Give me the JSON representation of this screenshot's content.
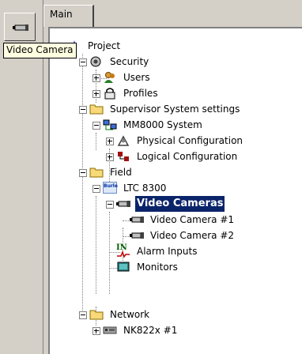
{
  "tab": {
    "label": "Main"
  },
  "tooltip": {
    "text": "Video Camera"
  },
  "toolbar": {
    "button_icon": "video-camera-icon"
  },
  "tree": {
    "project": "Project",
    "security": "Security",
    "users": "Users",
    "profiles": "Profiles",
    "supervisor": "Supervisor System settings",
    "mm8000": "MM8000 System",
    "physical": "Physical Configuration",
    "logical": "Logical Configuration",
    "field": "Field",
    "ltc": "LTC 8300",
    "ltc_icon_text": "Burle",
    "video_cameras": "Video Cameras",
    "cam1": "Video Camera #1",
    "cam2": "Video Camera #2",
    "alarm_inputs": "Alarm Inputs",
    "alarm_icon_text": "IN",
    "monitors": "Monitors",
    "network": "Network",
    "nk822": "NK822x #1"
  },
  "colors": {
    "selection": "#0a246a",
    "folder": "#f7d979",
    "tooltip_bg": "#ffffe1"
  }
}
